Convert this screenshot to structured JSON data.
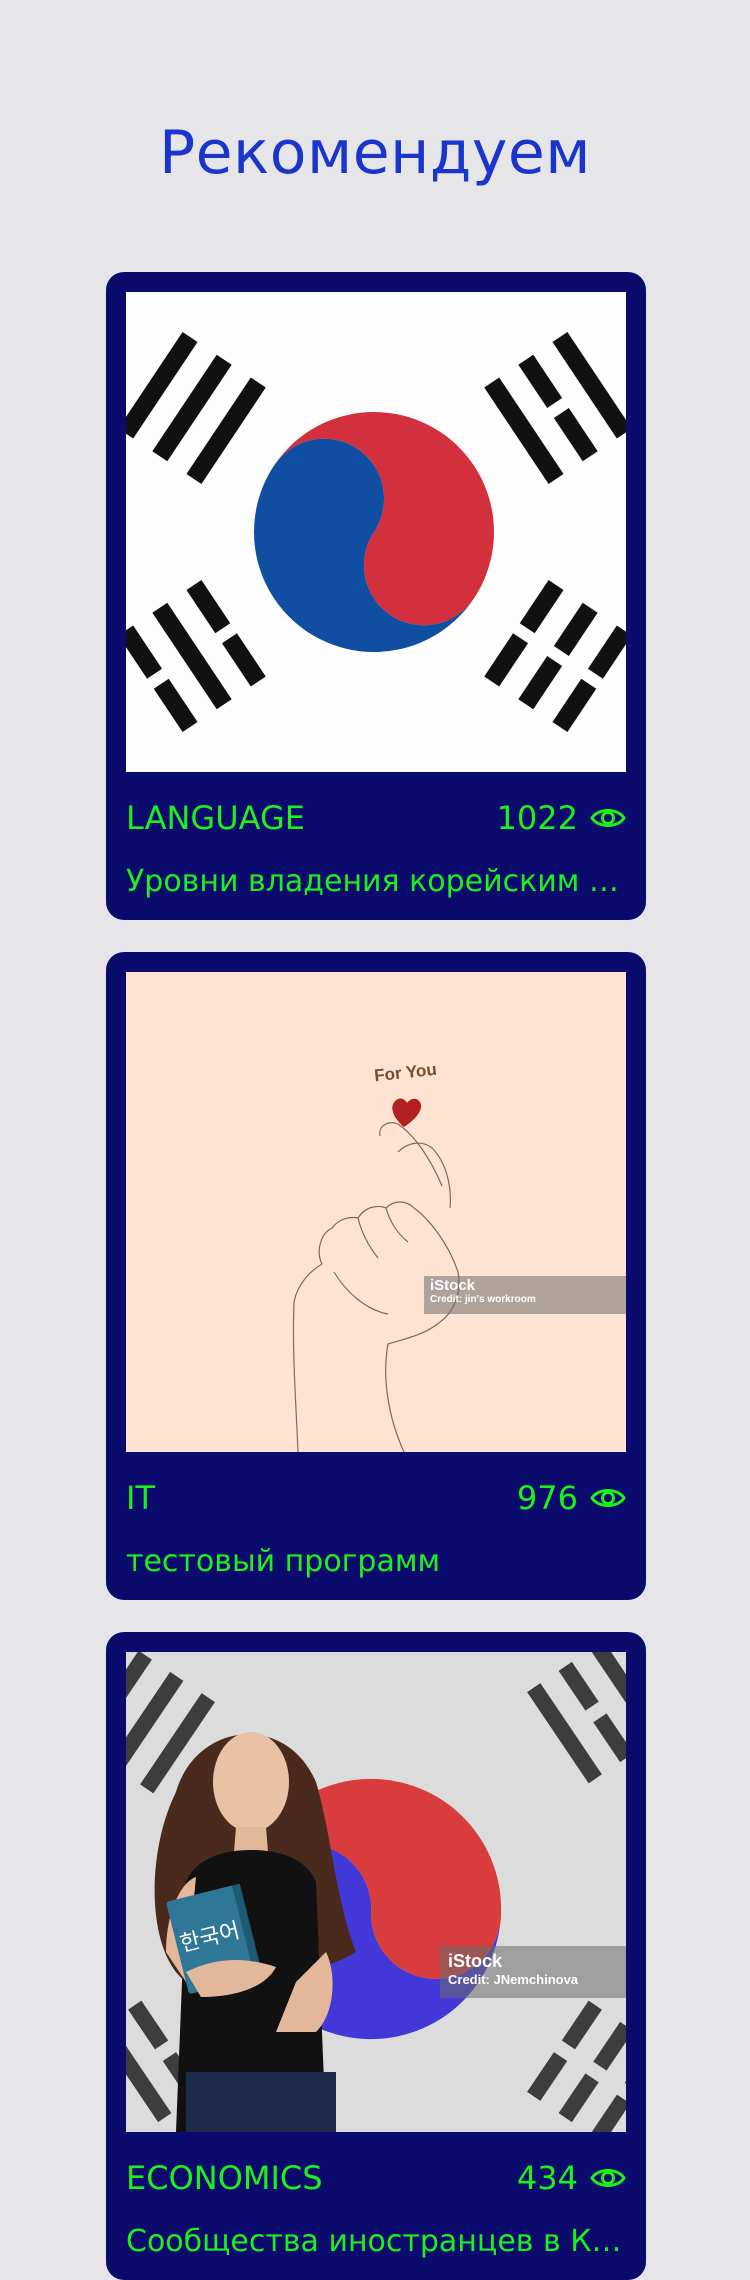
{
  "header": {
    "title": "Рекомендуем"
  },
  "cards": [
    {
      "category": "LANGUAGE",
      "views": "1022",
      "description": "Уровни владения корейским языком",
      "image": "korean-flag-image"
    },
    {
      "category": "IT",
      "views": "976",
      "description": "тестовый программ",
      "image": "finger-heart-illustration",
      "image_text": {
        "caption": "For You",
        "watermark": "iStock",
        "credit": "Credit: jin's workroom"
      }
    },
    {
      "category": "ECONOMICS",
      "views": "434",
      "description": "Сообщества иностранцев в Корее",
      "image": "woman-with-korean-book-image",
      "image_text": {
        "book": "한국어",
        "watermark": "iStock",
        "credit": "Credit: JNemchinova"
      }
    }
  ],
  "colors": {
    "background": "#e6e6e9",
    "title": "#1a35c9",
    "card": "#0b0b6e",
    "accent_text": "#1df01d"
  }
}
